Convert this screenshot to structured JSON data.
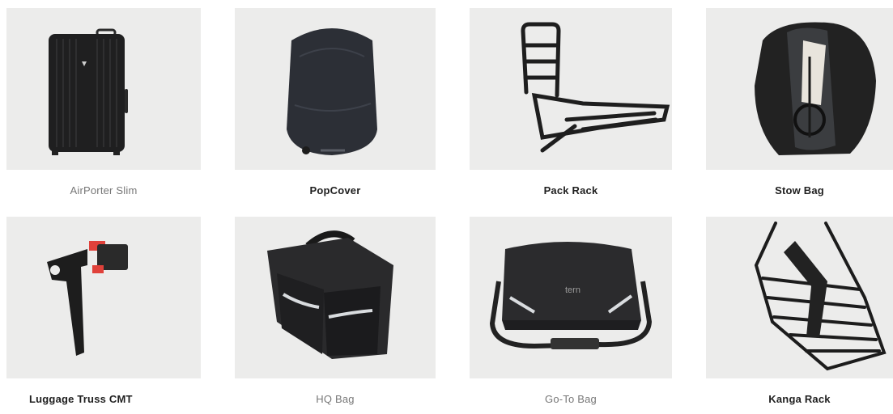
{
  "products": [
    {
      "id": "airporter-slim",
      "label": "AirPorter Slim",
      "emphasis": "light",
      "icon": "suitcase-image"
    },
    {
      "id": "popcover",
      "label": "PopCover",
      "emphasis": "dark",
      "icon": "bike-cover-image"
    },
    {
      "id": "pack-rack",
      "label": "Pack Rack",
      "emphasis": "dark",
      "icon": "front-rack-image"
    },
    {
      "id": "stow-bag",
      "label": "Stow Bag",
      "emphasis": "dark",
      "icon": "stow-bag-image"
    },
    {
      "id": "luggage-truss-cmt",
      "label": "Luggage Truss CMT",
      "emphasis": "dark",
      "icon": "luggage-truss-image"
    },
    {
      "id": "hq-bag",
      "label": "HQ Bag",
      "emphasis": "light",
      "icon": "hq-bag-image"
    },
    {
      "id": "go-to-bag",
      "label": "Go-To Bag",
      "emphasis": "light",
      "icon": "messenger-bag-image"
    },
    {
      "id": "kanga-rack",
      "label": "Kanga Rack",
      "emphasis": "dark",
      "icon": "kanga-rack-image"
    }
  ],
  "colors": {
    "tile": "#ececeb",
    "product": "#262626",
    "accent_red": "#e0413a",
    "reflective": "#d9dcdf"
  }
}
